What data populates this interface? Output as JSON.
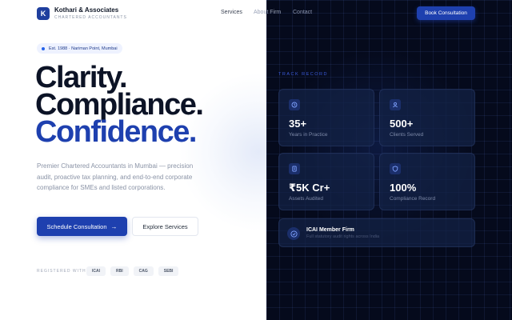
{
  "brand": {
    "logo_letter": "K",
    "name": "Kothari & Associates",
    "tagline": "CHARTERED ACCOUNTANTS"
  },
  "nav": {
    "items": [
      "Services",
      "About Firm",
      "Contact"
    ],
    "cta": "Book Consultation"
  },
  "hero": {
    "badge": "Est. 1988 · Nariman Point, Mumbai",
    "headline": [
      "Clarity.",
      "Compliance.",
      "Confidence."
    ],
    "description": "Premier Chartered Accountants in Mumbai — precision audit, proactive tax planning, and end-to-end corporate compliance for SMEs and listed corporations.",
    "primary_button": "Schedule Consultation",
    "secondary_button": "Explore Services",
    "registered_label": "REGISTERED WITH",
    "registrations": [
      "ICAI",
      "RBI",
      "CAG",
      "SEBI"
    ]
  },
  "track_record": {
    "title": "TRACK RECORD",
    "stats": [
      {
        "value": "35+",
        "label": "Years in Practice",
        "icon": "clock-icon"
      },
      {
        "value": "500+",
        "label": "Clients Served",
        "icon": "user-icon"
      },
      {
        "value": "₹5K Cr+",
        "label": "Assets Audited",
        "icon": "document-icon"
      },
      {
        "value": "100%",
        "label": "Compliance Record",
        "icon": "shield-icon"
      }
    ],
    "member": {
      "title": "ICAI Member Firm",
      "subtitle": "Full statutory audit rights across India",
      "icon": "shield-check-icon"
    }
  },
  "colors": {
    "accent": "#1e40af",
    "dark_panel": "#050a1c",
    "headline_dark": "#0c1326"
  }
}
